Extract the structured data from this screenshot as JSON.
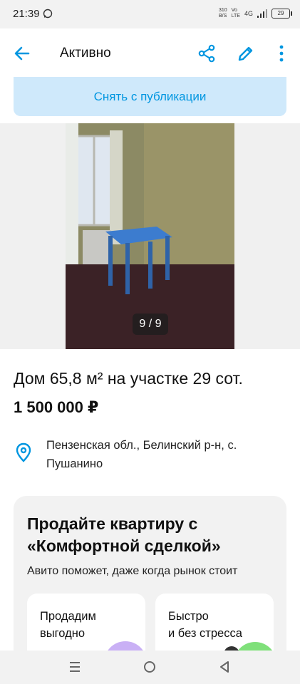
{
  "status_bar": {
    "time": "21:39",
    "net_speed_value": "310",
    "net_speed_unit": "B/S",
    "volte_top": "Vo",
    "volte_bottom": "LTE",
    "network": "4G",
    "battery": "29"
  },
  "app_bar": {
    "title": "Активно"
  },
  "actions": {
    "unpublish_label": "Снять с публикации"
  },
  "gallery": {
    "counter": "9 / 9"
  },
  "listing": {
    "title": "Дом 65,8 м² на участке 29 сот.",
    "price": "1 500 000 ₽",
    "location": "Пензенская обл., Белинский р-н, с. Пушанино"
  },
  "promo": {
    "title": "Продайте квартиру с «Комфортной сделкой»",
    "subtitle": "Авито поможет, даже когда рынок стоит",
    "benefits": [
      {
        "text": "Продадим\nвыгодно"
      },
      {
        "text": "Быстро\nи без стресса"
      }
    ]
  },
  "colors": {
    "accent": "#0096e0",
    "unpublish_bg": "#cfe9fb",
    "card_bg": "#f2f2f2"
  },
  "icons": [
    "whatsapp-icon",
    "signal-icon",
    "battery-icon",
    "back-arrow-icon",
    "share-icon",
    "edit-pencil-icon",
    "more-vertical-icon",
    "location-pin-icon",
    "nav-recents-icon",
    "nav-home-icon",
    "nav-back-icon"
  ]
}
